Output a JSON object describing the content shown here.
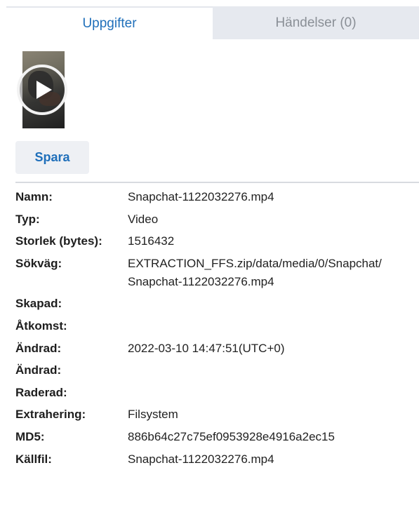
{
  "tabs": [
    {
      "label": "Uppgifter",
      "active": true
    },
    {
      "label": "Händelser (0)",
      "active": false
    }
  ],
  "media": {
    "thumbnail_icon": "play-icon"
  },
  "save_label": "Spara",
  "properties": [
    {
      "key": "Namn:",
      "value": "Snapchat-1122032276.mp4"
    },
    {
      "key": "Typ:",
      "value": "Video"
    },
    {
      "key": "Storlek (bytes):",
      "value": "1516432"
    },
    {
      "key": "Sökväg:",
      "value": "EXTRACTION_FFS.zip/data/media/0/Snapchat/",
      "value2": "Snapchat-1122032276.mp4"
    },
    {
      "key": "Skapad:",
      "value": ""
    },
    {
      "key": "Åtkomst:",
      "value": ""
    },
    {
      "key": "Ändrad:",
      "value": "2022-03-10 14:47:51(UTC+0)"
    },
    {
      "key": "Ändrad:",
      "value": ""
    },
    {
      "key": "Raderad:",
      "value": ""
    },
    {
      "key": "Extrahering:",
      "value": "Filsystem"
    },
    {
      "key": "MD5:",
      "value": "886b64c27c75ef0953928e4916a2ec15"
    },
    {
      "key": "Källfil:",
      "value": "Snapchat-1122032276.mp4"
    }
  ],
  "colors": {
    "accent": "#1f6fba",
    "tab_inactive_bg": "#e6e9ef",
    "button_bg": "#eef0f4"
  }
}
